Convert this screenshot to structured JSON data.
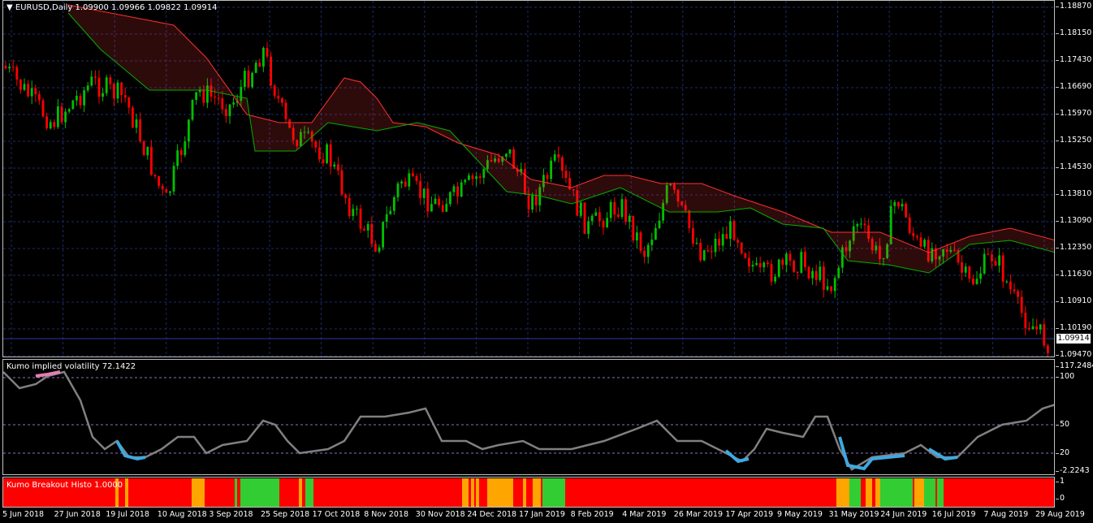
{
  "main_chart": {
    "title": "EURUSD,Daily",
    "ohlc": "1.09900 1.09966 1.09822 1.09914",
    "current_price": "1.09914",
    "price_ticks": [
      "1.18870",
      "1.18150",
      "1.17430",
      "1.16690",
      "1.15970",
      "1.15250",
      "1.14530",
      "1.13810",
      "1.13090",
      "1.12350",
      "1.11630",
      "1.10910",
      "1.10190",
      "1.09470"
    ],
    "colors": {
      "bull": "#00c000",
      "bear": "#ff0000",
      "kumo_bull": "#ffffff",
      "kumo_bear": "#ff4040",
      "grid": "#1e2a6a"
    }
  },
  "volatility": {
    "title": "Kumo implied volatility 72.1422",
    "ticks": [
      "117.2484",
      "100",
      "50",
      "20",
      "-2.2243"
    ],
    "color_line": "#808080",
    "color_low": "#40a8e0",
    "color_high": "#e080b0"
  },
  "histo": {
    "title": "Kumo Breakout Histo 1.0000",
    "ticks": [
      "1",
      "0"
    ],
    "colors": {
      "red": "#ff0000",
      "orange": "#ffa500",
      "green": "#32cd32"
    }
  },
  "dates": [
    "5 Jun 2018",
    "27 Jun 2018",
    "19 Jul 2018",
    "10 Aug 2018",
    "3 Sep 2018",
    "25 Sep 2018",
    "17 Oct 2018",
    "8 Nov 2018",
    "30 Nov 2018",
    "24 Dec 2018",
    "17 Jan 2019",
    "8 Feb 2019",
    "4 Mar 2019",
    "26 Mar 2019",
    "17 Apr 2019",
    "9 May 2019",
    "31 May 2019",
    "24 Jun 2019",
    "16 Jul 2019",
    "7 Aug 2019",
    "29 Aug 2019"
  ]
}
